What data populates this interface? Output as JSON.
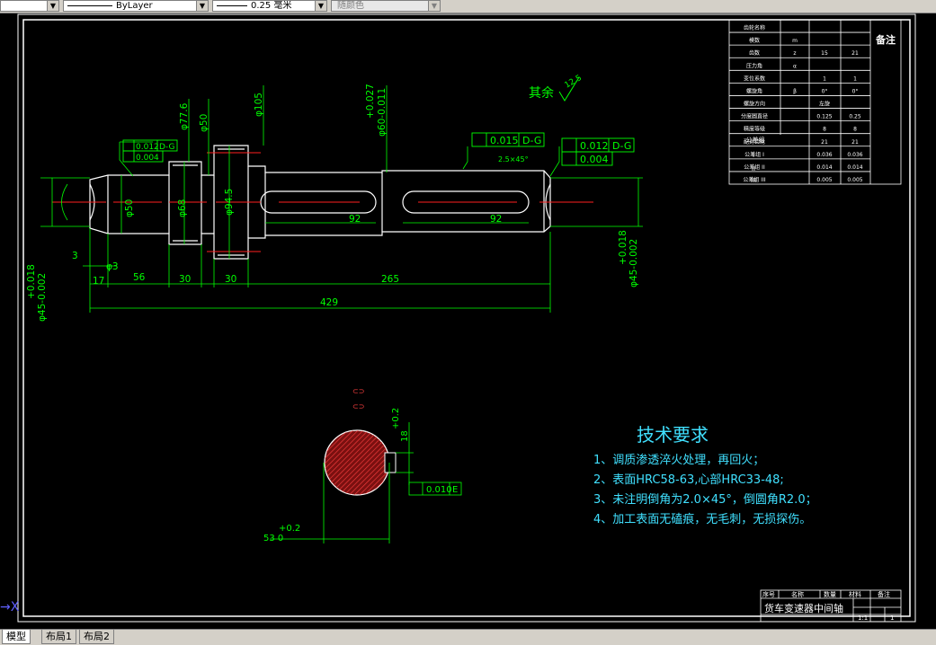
{
  "toolbar": {
    "linetype_value": "ByLayer",
    "lineweight_value": "0.25 毫米",
    "color_value": "随颜色"
  },
  "tabs": [
    "模型",
    "布局1",
    "布局2"
  ],
  "dims": {
    "d429": "429",
    "d265": "265",
    "d56": "56",
    "d30a": "30",
    "d30b": "30",
    "d17": "17",
    "d3": "3",
    "d92a": "92",
    "d92b": "92",
    "phi3": "φ3",
    "phi50": "φ50",
    "phi68": "φ68",
    "phi945": "φ94.5",
    "phi776": "φ77.6",
    "phi50top": "φ50",
    "phi105": "φ105",
    "phi60": "φ60-0.011",
    "phi60tol": "+0.027",
    "phi45l": "φ45-0.002",
    "phi45ltol": "+0.018",
    "phi45r": "φ45-0.002",
    "phi45rtol": "+0.018",
    "tol1a": "0.012",
    "tol1b": "D-G",
    "tol1c": "0.004",
    "tol2a": "0.015",
    "tol2b": "D-G",
    "tol3a": "0.012",
    "tol3b": "D-G",
    "tol3c": "0.004",
    "chamfer": "2.5×45°",
    "rest": "其余",
    "rest_val": "12.5",
    "sec_18": "18",
    "sec_tol": "+0.2",
    "sec_53": "53 0",
    "sec_53tol": "+0.2",
    "sec_box": "0.010",
    "sec_box_ref": "E"
  },
  "tech": {
    "title": "技术要求",
    "items": [
      "1、调质渗透淬火处理，再回火；",
      "2、表面HRC58-63,心部HRC33-48;",
      "3、未注明倒角为2.0×45°，倒圆角R2.0；",
      "4、加工表面无磕痕，无毛刺，无损探伤。"
    ]
  },
  "gear_table": {
    "remark": "备注",
    "params": [
      [
        "齿轮名称",
        "",
        "",
        ""
      ],
      [
        "模数",
        "m",
        "",
        ""
      ],
      [
        "齿数",
        "z",
        "15",
        "21"
      ],
      [
        "压力角",
        "α",
        "",
        ""
      ],
      [
        "变位系数",
        "",
        "1",
        "1"
      ],
      [
        "螺旋角",
        "β",
        "0°",
        "0°"
      ],
      [
        "螺旋方向",
        "",
        "左旋",
        ""
      ],
      [
        "分度圆直径",
        "",
        "0.125",
        "0.25"
      ],
      [
        "精度等级",
        "",
        "8",
        "8"
      ],
      [
        "配对齿轮",
        "",
        "21",
        "21"
      ],
      [
        "公差组 I",
        "",
        "0.036",
        "0.036"
      ],
      [
        "公差组 II",
        "",
        "0.014",
        "0.014"
      ],
      [
        "公差组 III",
        "",
        "0.005",
        "0.005"
      ]
    ],
    "tolgroup_label": "公差组",
    "roman": [
      "I",
      "II",
      "III"
    ]
  },
  "title_block": {
    "part_name": "货车变速器中间轴",
    "headers": [
      "序号",
      "名称",
      "数量",
      "材料",
      "备注"
    ],
    "scale": "1:1",
    "sheet": "1"
  }
}
